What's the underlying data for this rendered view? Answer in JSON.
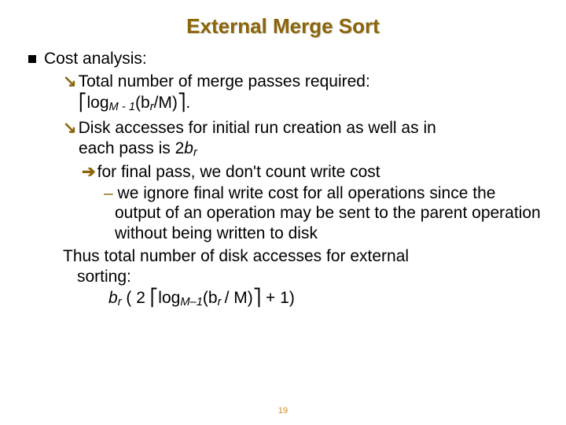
{
  "title": "External Merge Sort",
  "bullet1": "Cost analysis:",
  "sub1_lead": "Total number of merge passes required:",
  "sub1_formula_pre": "log",
  "sub1_formula_sub": "M - 1",
  "sub1_formula_mid": "(b",
  "sub1_formula_sub2": "r",
  "sub1_formula_post": "/M)",
  "sub1_formula_end": ".",
  "sub2_a": "Disk accesses for initial run creation as well as in",
  "sub2_b": "each pass is 2",
  "sub2_b_it": "b",
  "sub2_b_sub": "r",
  "sub3": "for final pass, we don't count write cost",
  "sub4_dash": "–",
  "sub4": " we ignore final write cost for all operations since the output of an operation may be sent to the parent operation without being written to disk",
  "thus_a": "Thus total number of disk accesses for external",
  "thus_b": "sorting:",
  "final_br": "b",
  "final_r": "r",
  "final_open": " ( 2 ",
  "final_log": "log",
  "final_sub": "M–1",
  "final_paren": "(b",
  "final_r2": "r ",
  "final_m": "/ M)",
  "final_tail": " + 1)",
  "ceil_l": "⎡",
  "ceil_r": "⎤",
  "arrow_down": "ê",
  "arrow_right": "è",
  "pagenum": "19"
}
